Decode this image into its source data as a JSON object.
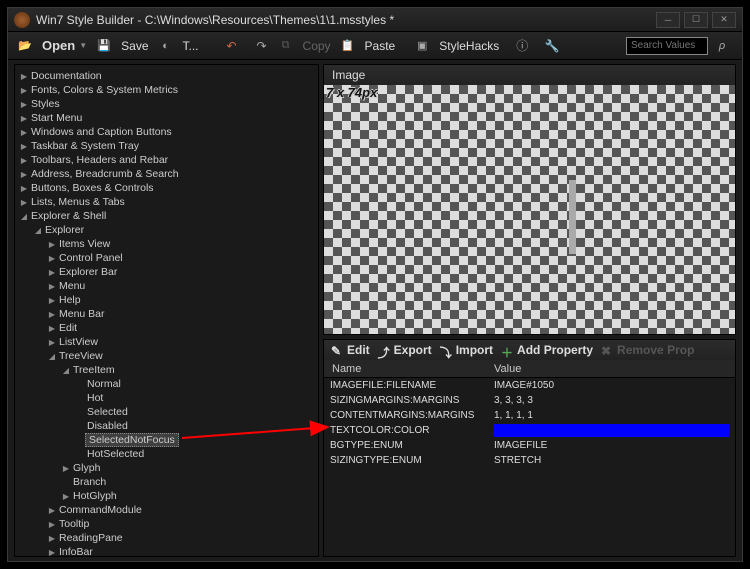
{
  "window": {
    "title": "Win7 Style Builder - C:\\Windows\\Resources\\Themes\\1\\1.msstyles *"
  },
  "toolbar": {
    "open": "Open",
    "save": "Save",
    "test": "T...",
    "copy": "Copy",
    "paste": "Paste",
    "stylehacks": "StyleHacks"
  },
  "search": {
    "placeholder": "Search Values"
  },
  "tree": [
    {
      "d": 0,
      "a": "▶",
      "t": "Documentation"
    },
    {
      "d": 0,
      "a": "▶",
      "t": "Fonts, Colors & System Metrics"
    },
    {
      "d": 0,
      "a": "▶",
      "t": "Styles"
    },
    {
      "d": 0,
      "a": "▶",
      "t": "Start Menu"
    },
    {
      "d": 0,
      "a": "▶",
      "t": "Windows and Caption Buttons"
    },
    {
      "d": 0,
      "a": "▶",
      "t": "Taskbar & System Tray"
    },
    {
      "d": 0,
      "a": "▶",
      "t": "Toolbars, Headers and Rebar"
    },
    {
      "d": 0,
      "a": "▶",
      "t": "Address, Breadcrumb & Search"
    },
    {
      "d": 0,
      "a": "▶",
      "t": "Buttons, Boxes & Controls"
    },
    {
      "d": 0,
      "a": "▶",
      "t": "Lists, Menus & Tabs"
    },
    {
      "d": 0,
      "a": "◢",
      "t": "Explorer & Shell"
    },
    {
      "d": 1,
      "a": "◢",
      "t": "Explorer"
    },
    {
      "d": 2,
      "a": "▶",
      "t": "Items View"
    },
    {
      "d": 2,
      "a": "▶",
      "t": "Control Panel"
    },
    {
      "d": 2,
      "a": "▶",
      "t": "Explorer Bar"
    },
    {
      "d": 2,
      "a": "▶",
      "t": "Menu"
    },
    {
      "d": 2,
      "a": "▶",
      "t": "Help"
    },
    {
      "d": 2,
      "a": "▶",
      "t": "Menu Bar"
    },
    {
      "d": 2,
      "a": "▶",
      "t": "Edit"
    },
    {
      "d": 2,
      "a": "▶",
      "t": "ListView"
    },
    {
      "d": 2,
      "a": "◢",
      "t": "TreeView"
    },
    {
      "d": 3,
      "a": "◢",
      "t": "TreeItem"
    },
    {
      "d": 4,
      "a": "",
      "t": "Normal"
    },
    {
      "d": 4,
      "a": "",
      "t": "Hot"
    },
    {
      "d": 4,
      "a": "",
      "t": "Selected"
    },
    {
      "d": 4,
      "a": "",
      "t": "Disabled"
    },
    {
      "d": 4,
      "a": "",
      "t": "SelectedNotFocus",
      "sel": true
    },
    {
      "d": 4,
      "a": "",
      "t": "HotSelected"
    },
    {
      "d": 3,
      "a": "▶",
      "t": "Glyph"
    },
    {
      "d": 3,
      "a": "",
      "t": "Branch"
    },
    {
      "d": 3,
      "a": "▶",
      "t": "HotGlyph"
    },
    {
      "d": 2,
      "a": "▶",
      "t": "CommandModule"
    },
    {
      "d": 2,
      "a": "▶",
      "t": "Tooltip"
    },
    {
      "d": 2,
      "a": "▶",
      "t": "ReadingPane"
    },
    {
      "d": 2,
      "a": "▶",
      "t": "InfoBar"
    }
  ],
  "image_panel": {
    "title": "Image",
    "dimensions": "7 x 74px"
  },
  "props_toolbar": {
    "edit": "Edit",
    "export": "Export",
    "import": "Import",
    "add": "Add Property",
    "remove": "Remove Prop"
  },
  "props_columns": {
    "name": "Name",
    "value": "Value"
  },
  "props": [
    {
      "n": "IMAGEFILE:FILENAME",
      "v": "IMAGE#1050"
    },
    {
      "n": "SIZINGMARGINS:MARGINS",
      "v": "3, 3, 3, 3"
    },
    {
      "n": "CONTENTMARGINS:MARGINS",
      "v": "1, 1, 1, 1"
    },
    {
      "n": "TEXTCOLOR:COLOR",
      "v": "",
      "swatch": "#0000ff"
    },
    {
      "n": "BGTYPE:ENUM",
      "v": "IMAGEFILE"
    },
    {
      "n": "SIZINGTYPE:ENUM",
      "v": "STRETCH"
    }
  ]
}
